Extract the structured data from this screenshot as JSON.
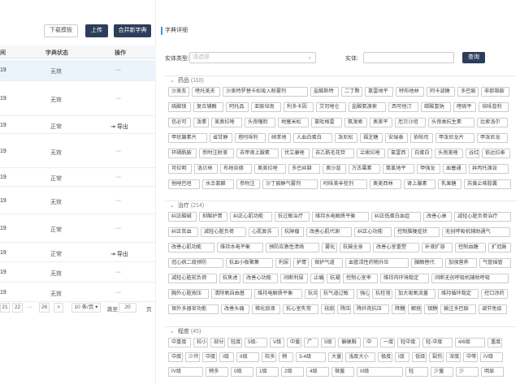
{
  "left": {
    "toolbar": {
      "download_label": "下载模板",
      "upload_label": "上传",
      "merge_label": "合并新字典"
    },
    "table": {
      "headers": {
        "date": "间",
        "status": "字典状态",
        "ops": "操作"
      },
      "rows": [
        {
          "date": "19",
          "status": "无效",
          "op": "···"
        },
        {
          "date": "19",
          "status": "无效",
          "op": "···"
        },
        {
          "date": "19",
          "status": "正常",
          "op": "导出"
        },
        {
          "date": "19",
          "status": "无效",
          "op": "···"
        },
        {
          "date": "19",
          "status": "正常",
          "op": "···"
        },
        {
          "date": "19",
          "status": "无效",
          "op": "···"
        },
        {
          "date": "19",
          "status": "正常",
          "op": "···"
        },
        {
          "date": "19",
          "status": "正常",
          "op": "导出"
        },
        {
          "date": "19",
          "status": "无效",
          "op": "···"
        },
        {
          "date": "19",
          "status": "无效",
          "op": "···"
        }
      ]
    },
    "pager": {
      "pages": [
        "21",
        "22",
        "···",
        "26",
        ">"
      ],
      "page_size": "10 条/页",
      "jump_label": "跳至",
      "jump_value": "20",
      "page_unit": "页"
    }
  },
  "right": {
    "tab_label": "字典详细",
    "query": {
      "type_label": "实体类型:",
      "type_placeholder": "请选择",
      "entity_label": "实体:",
      "search_label": "查询"
    },
    "sections": [
      {
        "title": "药品",
        "count": "(110)",
        "tags": [
          [
            "沙美车",
            "喹托美夫",
            "沙美特罗替卡松吸入粉雾剂",
            "盐酸斯特",
            "二丁颗",
            "氯雷地平",
            "特布他林",
            "阿卡波糖",
            "多巴胺",
            "非那雄胺"
          ],
          [
            "硫酸镁",
            "复合辅酶",
            "阿托品",
            "亚胺培南",
            "利多卡因",
            "艾司唑仑",
            "盐酸氨溴索",
            "西可他汀",
            "碳酸氢钠",
            "喹硫平",
            "培哚普利"
          ],
          [
            "信必可",
            "泼素",
            "美奥拉唑",
            "头孢噻肟",
            "地塞米松",
            "氯吡格雷",
            "氨溴索",
            "奥美平",
            "厄贝沙坦",
            "头孢类抗生素",
            "比索洛尔"
          ],
          [
            "甲状腺素片",
            "省甘醇",
            "塔吲哚利",
            "硝苯地",
            "人血白蛋白",
            "泼尼松",
            "福芝糖",
            "安瑞泰",
            "依帕司",
            "甲泼尼龙片",
            "甲泼尼龙"
          ],
          [
            "环磷酰胺",
            "参附注射液",
            "去甲肾上腺素",
            "伏立康唑",
            "去乙酰毛花苷",
            "兰索拉唑",
            "氯雷西",
            "白蛋白",
            "头孢美唑",
            "谷红",
            "依达拉奉"
          ],
          [
            "可拉明",
            "洛贝林",
            "布地奈德",
            "奥美拉唑",
            "多巴丝肼",
            "奥沙普",
            "万古霉素",
            "氨氯地平",
            "甲强龙",
            "血塞通",
            "异丙托溴铵"
          ],
          [
            "他唑巴坦",
            "水合氯醛",
            "参附注",
            "沙丁胺醇气雾剂",
            "吲哚美辛栓剂",
            "奥美西林",
            "肾上腺素",
            "乳果糖",
            "苏黄止咳胶囊"
          ]
        ]
      },
      {
        "title": "治疗",
        "count": "(214)",
        "tags": [
          [
            "纠正酸碱",
            "抑酸护胃",
            "纠正心肌功能",
            "抗过敏治疗",
            "维持水电解质平衡",
            "纠正低蛋白血症",
            "改善心衰",
            "减轻心脏负荷治疗"
          ],
          [
            "纠正贫血",
            "减轻心脏负荷",
            "心肌复苏",
            "抗肿瘤",
            "改善心肌代谢",
            "纠正心功能",
            "控制脑梗症状",
            "无创呼吸机辅助通气"
          ],
          [
            "改善心肌功能",
            "维持水电平衡",
            "预防应激性溃疡",
            "雾化",
            "抗输全身",
            "改善心室重塑",
            "补液扩容",
            "控制血糖",
            "扩冠脉"
          ],
          [
            "冠心病二级预防",
            "抗血小板聚集",
            "利尿",
            "护胃",
            "保护气道",
            "血管活性药物升压",
            "胰酶替代",
            "加强营养",
            "气管插管"
          ],
          [
            "减轻心脏前负荷",
            "抗焦虑",
            "改善心功能",
            "间断利尿",
            "止痛",
            "抗凝",
            "控制心室率",
            "维持内环境稳定",
            "间断无创呼吸机辅助呼吸"
          ],
          [
            "胸外心脏按压",
            "清除氧自由基",
            "维持电解质平衡",
            "抗炎",
            "抗气道过敏",
            "强心",
            "抗栓溶",
            "加大吸氧流量",
            "维持循环稳定",
            "控口涂药"
          ],
          [
            "保外多器官功能",
            "改善头痛",
            "稀化痰液",
            "抗心室失常",
            "祛痰",
            "降压",
            "降纤肉抗压",
            "降糖",
            "解痉",
            "镇静",
            "输注多巴胺",
            "调节免疫"
          ]
        ]
      },
      {
        "title": "程度",
        "count": "(45)",
        "tags": [
          [
            "中重度",
            "较小",
            "部分",
            "轻度",
            "5级-",
            "V级",
            "中量",
            "广",
            "5级",
            "偏硬胸",
            "中",
            "一度",
            "轻中度",
            "轻-中度",
            "4/6级",
            "重度"
          ],
          [
            "中度",
            "少许",
            "中度",
            "I级",
            "II级",
            "较多",
            "稍",
            "3-4级",
            "大量",
            "浅度大小",
            "极度",
            "I度",
            "低级",
            "裂伤",
            "深度",
            "中等",
            "IV级"
          ],
          [
            "IV级",
            "稍多",
            "0级",
            "1级",
            "2级",
            "4级",
            "微量",
            "III级",
            "轻",
            "少量",
            "少",
            "明显"
          ]
        ]
      }
    ]
  }
}
